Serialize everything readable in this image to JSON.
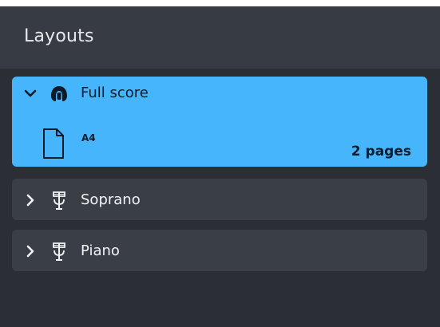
{
  "panel": {
    "title": "Layouts"
  },
  "layouts": [
    {
      "name": "Full score",
      "type_icon": "full-score-icon",
      "expanded": true,
      "selected": true,
      "pages": [
        {
          "size": "A4",
          "count": "2 pages"
        }
      ]
    },
    {
      "name": "Soprano",
      "type_icon": "part-layout-icon",
      "expanded": false,
      "selected": false
    },
    {
      "name": "Piano",
      "type_icon": "part-layout-icon",
      "expanded": false,
      "selected": false
    }
  ],
  "colors": {
    "panel_background": "#2b2e34",
    "header_background": "#373c44",
    "card_background": "#3a3f47",
    "selected_background": "#47b5fb"
  }
}
